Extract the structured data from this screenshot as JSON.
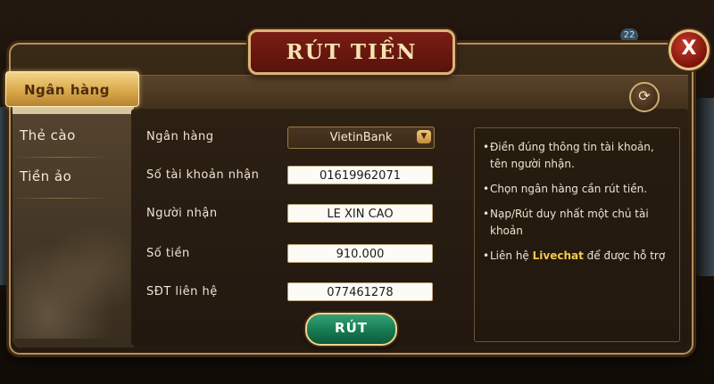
{
  "title": "RÚT TIỀN",
  "close_label": "X",
  "history_icon": "⟳",
  "badge": "22",
  "tabs": [
    {
      "label": "Ngân hàng",
      "active": true
    },
    {
      "label": "Thẻ cào",
      "active": false
    },
    {
      "label": "Tiền ảo",
      "active": false
    }
  ],
  "form": {
    "bank_label": "Ngân hàng",
    "bank_value": "VietinBank",
    "account_label": "Số tài khoản nhận",
    "account_value": "01619962071",
    "recipient_label": "Người nhận",
    "recipient_value": "LE XIN CAO",
    "amount_label": "Số tiền",
    "amount_value": "910.000",
    "phone_label": "SĐT liên hệ",
    "phone_value": "077461278",
    "submit_label": "RÚT"
  },
  "notes": {
    "n1": "Điền đúng thông tin tài khoản, tên người nhận.",
    "n2": "Chọn ngân hàng cần rút tiền.",
    "n3": "Nạp/Rút duy nhất một chủ tài khoản",
    "n4_pre": "Liên hệ ",
    "n4_link": "Livechat",
    "n4_post": " để được hỗ trợ"
  },
  "colors": {
    "accent_gold": "#d9a94c",
    "title_red": "#7a1d14",
    "submit_green": "#167a52",
    "highlight": "#f3c94d"
  }
}
